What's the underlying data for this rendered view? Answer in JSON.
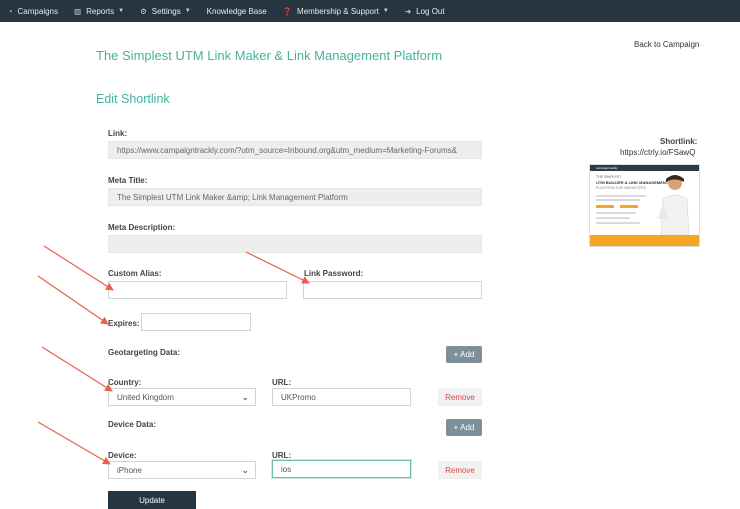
{
  "nav": [
    {
      "icon": "dashboard-icon",
      "glyph": "◔",
      "label": "Campaigns",
      "dropdown": false
    },
    {
      "icon": "bar-chart-icon",
      "glyph": "▥",
      "label": "Reports",
      "dropdown": true
    },
    {
      "icon": "gear-icon",
      "glyph": "⚙",
      "label": "Settings",
      "dropdown": true
    },
    {
      "icon": "",
      "glyph": "",
      "label": "Knowledge Base",
      "dropdown": false
    },
    {
      "icon": "help-icon",
      "glyph": "❓",
      "label": "Membership & Support",
      "dropdown": true
    },
    {
      "icon": "logout-icon",
      "glyph": "➜",
      "label": "Log Out",
      "dropdown": false
    }
  ],
  "page_title": "The Simplest UTM Link Maker & Link Management Platform",
  "back_link": "Back to Campaign",
  "section_title": "Edit Shortlink",
  "form": {
    "link_label": "Link:",
    "link_value": "https://www.campaigntrackly.com/?utm_source=Inbound.org&utm_medium=Marketing-Forums&",
    "meta_title_label": "Meta Title:",
    "meta_title_value": "The Simplest UTM Link Maker &amp; Link Management Platform",
    "meta_description_label": "Meta Description:",
    "meta_description_value": "",
    "custom_alias_label": "Custom Alias:",
    "custom_alias_value": "",
    "link_password_label": "Link Password:",
    "link_password_value": "",
    "expires_label": "Expires:",
    "expires_value": "",
    "geo_label": "Geotargeting Data:",
    "add_label": "+ Add",
    "country_label": "Country:",
    "country_value": "United Kingdom",
    "geo_url_label": "URL:",
    "geo_url_value": "UKPromo",
    "remove_label": "Remove",
    "device_data_label": "Device Data:",
    "device_label": "Device:",
    "device_value": "iPhone",
    "device_url_label": "URL:",
    "device_url_value": "ios",
    "update_label": "Update"
  },
  "shortlink": {
    "label": "Shortlink:",
    "url": "https://ctrly.io/FSawQ"
  },
  "thumbnail": {
    "logo": "campaigntrackly",
    "line1": "THE SIMPLEST",
    "line2": "UTM BUILDER & LINK MANAGEMENT",
    "line3": "PLATFORM FOR MARKETERS"
  },
  "colors": {
    "nav_bg": "#273541",
    "accent": "#45b29d",
    "arrow": "#e8604c",
    "remove": "#e0463d"
  }
}
